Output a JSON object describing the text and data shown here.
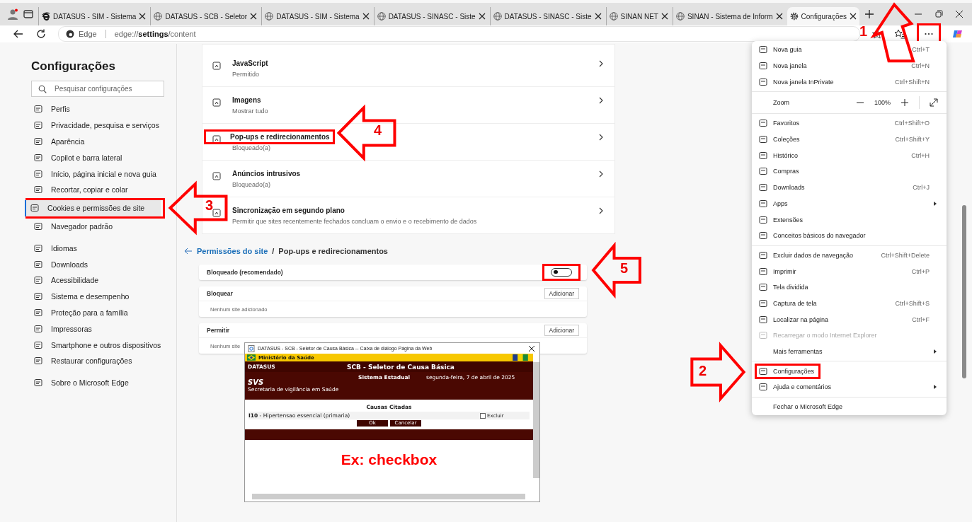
{
  "tabs": [
    {
      "title": "DATASUS - SIM - Sistema",
      "selected": false
    },
    {
      "title": "DATASUS - SCB - Seletor",
      "selected": false
    },
    {
      "title": "DATASUS - SIM - Sistema",
      "selected": false
    },
    {
      "title": "DATASUS - SINASC - Siste",
      "selected": false
    },
    {
      "title": "DATASUS - SINASC - Siste",
      "selected": false
    },
    {
      "title": "SINAN NET",
      "selected": false
    },
    {
      "title": "SINAN - Sistema de Inform",
      "selected": false
    },
    {
      "title": "Configurações",
      "selected": true
    }
  ],
  "address_bar": {
    "site_label": "Edge",
    "url": "edge://**settings**/content"
  },
  "sidebar": {
    "title": "Configurações",
    "search": {
      "placeholder": "Pesquisar configurações"
    },
    "groups": [
      [
        {
          "label": "Perfis",
          "selected": false
        },
        {
          "label": "Privacidade, pesquisa e serviços",
          "selected": false
        },
        {
          "label": "Aparência",
          "selected": false
        },
        {
          "label": "Copilot e barra lateral",
          "selected": false
        },
        {
          "label": "Início, página inicial e nova guia",
          "selected": false
        },
        {
          "label": "Recortar, copiar e colar",
          "selected": false
        },
        {
          "label": "Cookies e permissões de site",
          "selected": true
        },
        {
          "label": "Navegador padrão",
          "selected": false
        }
      ],
      [
        {
          "label": "Idiomas",
          "selected": false
        },
        {
          "label": "Downloads",
          "selected": false
        },
        {
          "label": "Acessibilidade",
          "selected": false
        },
        {
          "label": "Sistema e desempenho",
          "selected": false
        },
        {
          "label": "Proteção para a família",
          "selected": false
        },
        {
          "label": "Impressoras",
          "selected": false
        },
        {
          "label": "Smartphone e outros dispositivos",
          "selected": false
        },
        {
          "label": "Restaurar configurações",
          "selected": false
        }
      ],
      [
        {
          "label": "Sobre o Microsoft Edge",
          "selected": false
        }
      ]
    ]
  },
  "content_rows": [
    {
      "title": "JavaScript",
      "subtitle": "Permitido"
    },
    {
      "title": "Imagens",
      "subtitle": "Mostrar tudo"
    },
    {
      "title": "Pop-ups e redirecionamentos",
      "subtitle": "Bloqueado(a)"
    },
    {
      "title": "Anúncios intrusivos",
      "subtitle": "Bloqueado(a)"
    },
    {
      "title": "Sincronização em segundo plano",
      "subtitle": "Permitir que sites recentemente fechados concluam o envio e o recebimento de dados"
    }
  ],
  "breadcrumb": {
    "parent": "Permissões do site",
    "separator": "/",
    "current": "Pop-ups e redirecionamentos"
  },
  "toggle_setting": {
    "label": "Bloqueado (recomendado)",
    "on": false
  },
  "site_lists": [
    {
      "title": "Bloquear",
      "button": "Adicionar",
      "empty_text": "Nenhum site adicionado"
    },
    {
      "title": "Permitir",
      "button": "Adicionar",
      "empty_text": "Nenhum site"
    }
  ],
  "menu": {
    "groups": [
      [
        {
          "kind": "item",
          "label": "Nova guia",
          "shortcut": "Ctrl+T",
          "icon": true,
          "submenu": false,
          "disabled": false
        },
        {
          "kind": "item",
          "label": "Nova janela",
          "shortcut": "Ctrl+N",
          "icon": true,
          "submenu": false,
          "disabled": false
        },
        {
          "kind": "item",
          "label": "Nova janela InPrivate",
          "shortcut": "Ctrl+Shift+N",
          "icon": true,
          "submenu": false,
          "disabled": false
        }
      ],
      [
        {
          "kind": "zoom",
          "label": "Zoom",
          "value": "100%"
        }
      ],
      [
        {
          "kind": "item",
          "label": "Favoritos",
          "shortcut": "Ctrl+Shift+O",
          "icon": true,
          "submenu": false,
          "disabled": false
        },
        {
          "kind": "item",
          "label": "Coleções",
          "shortcut": "Ctrl+Shift+Y",
          "icon": true,
          "submenu": false,
          "disabled": false
        },
        {
          "kind": "item",
          "label": "Histórico",
          "shortcut": "Ctrl+H",
          "icon": true,
          "submenu": false,
          "disabled": false
        },
        {
          "kind": "item",
          "label": "Compras",
          "icon": true,
          "submenu": false,
          "disabled": false
        },
        {
          "kind": "item",
          "label": "Downloads",
          "shortcut": "Ctrl+J",
          "icon": true,
          "submenu": false,
          "disabled": false
        },
        {
          "kind": "item",
          "label": "Apps",
          "icon": true,
          "submenu": true,
          "disabled": false
        },
        {
          "kind": "item",
          "label": "Extensões",
          "icon": true,
          "submenu": false,
          "disabled": false
        },
        {
          "kind": "item",
          "label": "Conceitos básicos do navegador",
          "icon": true,
          "submenu": false,
          "disabled": false
        }
      ],
      [
        {
          "kind": "item",
          "label": "Excluir dados de navegação",
          "shortcut": "Ctrl+Shift+Delete",
          "icon": true,
          "submenu": false,
          "disabled": false
        },
        {
          "kind": "item",
          "label": "Imprimir",
          "shortcut": "Ctrl+P",
          "icon": true,
          "submenu": false,
          "disabled": false
        },
        {
          "kind": "item",
          "label": "Tela dividida",
          "icon": true,
          "submenu": false,
          "disabled": false
        },
        {
          "kind": "item",
          "label": "Captura de tela",
          "shortcut": "Ctrl+Shift+S",
          "icon": true,
          "submenu": false,
          "disabled": false
        },
        {
          "kind": "item",
          "label": "Localizar na página",
          "shortcut": "Ctrl+F",
          "icon": true,
          "submenu": false,
          "disabled": false
        },
        {
          "kind": "item",
          "label": "Recarregar o modo Internet Explorer",
          "icon": true,
          "submenu": false,
          "disabled": true
        },
        {
          "kind": "item",
          "label": "Mais ferramentas",
          "icon": false,
          "submenu": true,
          "disabled": false
        }
      ],
      [
        {
          "kind": "item",
          "label": "Configurações",
          "icon": true,
          "submenu": false,
          "disabled": false
        },
        {
          "kind": "item",
          "label": "Ajuda e comentários",
          "icon": true,
          "submenu": true,
          "disabled": false
        }
      ],
      [
        {
          "kind": "item",
          "label": "Fechar o Microsoft Edge",
          "icon": false,
          "submenu": false,
          "disabled": false
        }
      ]
    ]
  },
  "dialog": {
    "title": "DATASUS - SCB - Seletor de Causa Básica -- Caixa de diálogo Página da Web",
    "ministry": "Ministério da Saúde",
    "logo": "DATASUS",
    "app_title": "SCB - Seletor de Causa Básica",
    "system": "Sistema Estadual",
    "date": "segunda-feira, 7 de abril de 2025",
    "svs_logo": "SVS",
    "svs_name": "Secretaria de vigilância em Saúde",
    "section": "Causas Citadas",
    "cause": "**I10** - Hipertensao essencial (primaria)",
    "exclude": {
      "label": "Excluir",
      "checked": false
    },
    "buttons": [
      "Ok",
      "Cancelar"
    ]
  },
  "annotations": [
    {
      "number": "1"
    },
    {
      "number": "2"
    },
    {
      "number": "3"
    },
    {
      "number": "4"
    },
    {
      "number": "5"
    }
  ],
  "note": "Ex: checkbox"
}
